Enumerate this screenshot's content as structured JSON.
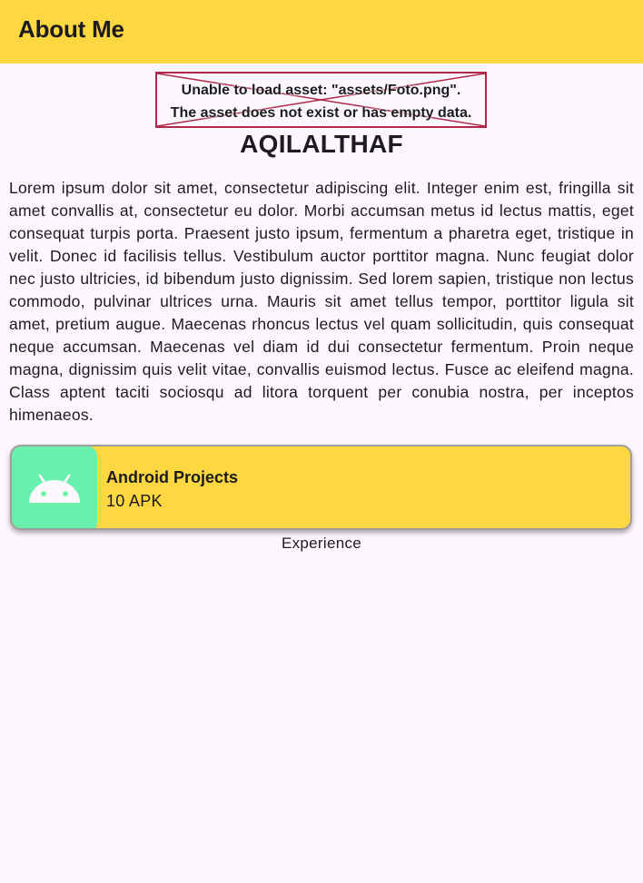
{
  "app_bar": {
    "title": "About Me",
    "background_color": "#ffd740"
  },
  "profile_image": {
    "error_line_1": "Unable to load asset: \"assets/Foto.png\".",
    "error_line_2": "The asset does not exist or has empty data.",
    "error_border_color": "#b0284a"
  },
  "profile": {
    "name": "AQILALTHAF",
    "bio": "Lorem ipsum dolor sit amet, consectetur adipiscing elit. Integer enim est, fringilla sit amet convallis at, consectetur eu dolor. Morbi accumsan metus id lectus mattis, eget consequat turpis porta. Praesent justo ipsum, fermentum a pharetra eget, tristique in velit. Donec id facilisis tellus. Vestibulum auctor porttitor magna. Nunc feugiat dolor nec justo ultricies, id bibendum justo dignissim. Sed lorem sapien, tristique non lectus commodo, pulvinar ultrices urna. Mauris sit amet tellus tempor, porttitor ligula sit amet, pretium augue. Maecenas rhoncus lectus vel quam sollicitudin, quis consequat neque accumsan. Maecenas vel diam id dui consectetur fermentum. Proin neque magna, dignissim quis velit vitae, convallis euismod lectus. Fusce ac eleifend magna. Class aptent taciti sociosqu ad litora torquent per conubia nostra, per inceptos himenaeos."
  },
  "project_card": {
    "icon": "android-icon",
    "icon_background": "#69f0ae",
    "card_color": "#ffd740",
    "title": "Android Projects",
    "subtitle": "10 APK"
  },
  "section_caption": "Experience"
}
